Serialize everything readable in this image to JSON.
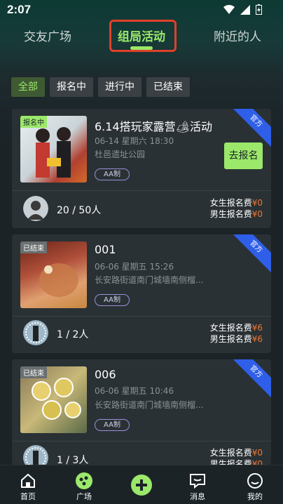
{
  "status": {
    "time": "2:07"
  },
  "tabs": [
    {
      "label": "交友广场"
    },
    {
      "label": "组局活动"
    },
    {
      "label": "附近的人"
    }
  ],
  "filters": [
    {
      "label": "全部"
    },
    {
      "label": "报名中"
    },
    {
      "label": "进行中"
    },
    {
      "label": "已结束"
    }
  ],
  "cards": [
    {
      "badge": "报名中",
      "ribbon": "官方",
      "title": "6.14搭玩家露营🏕活动",
      "datetime": "06-14 星期六 18:30",
      "location": "杜邑遗址公园",
      "tag": "AA制",
      "join_label": "去报名",
      "count": "20 / 50人",
      "female_fee_label": "女生报名费",
      "female_fee": "¥0",
      "male_fee_label": "男生报名费",
      "male_fee": "¥0"
    },
    {
      "badge": "已结束",
      "ribbon": "官方",
      "title": "001",
      "datetime": "06-06 星期五 15:26",
      "location": "长安路街道南门城墙南侧榴...",
      "tag": "AA制",
      "count": "1 / 2人",
      "female_fee_label": "女生报名费",
      "female_fee": "¥6",
      "male_fee_label": "男生报名费",
      "male_fee": "¥6"
    },
    {
      "badge": "已结束",
      "ribbon": "官方",
      "title": "006",
      "datetime": "06-06 星期五 10:46",
      "location": "长安路街道南门城墙南侧榴...",
      "tag": "AA制",
      "count": "1 / 3人",
      "female_fee_label": "女生报名费",
      "female_fee": "¥0",
      "male_fee_label": "男生报名费",
      "male_fee": "¥0"
    }
  ],
  "bottom_nav": [
    {
      "label": "首页",
      "icon": "home-icon"
    },
    {
      "label": "广场",
      "icon": "square-icon"
    },
    {
      "label": "",
      "icon": "plus-icon"
    },
    {
      "label": "消息",
      "icon": "message-icon"
    },
    {
      "label": "我的",
      "icon": "profile-icon"
    }
  ],
  "colors": {
    "accent": "#9be86a",
    "fee": "#f0772e",
    "ribbon": "#2f5fe8",
    "highlight_box": "#e0402a"
  }
}
